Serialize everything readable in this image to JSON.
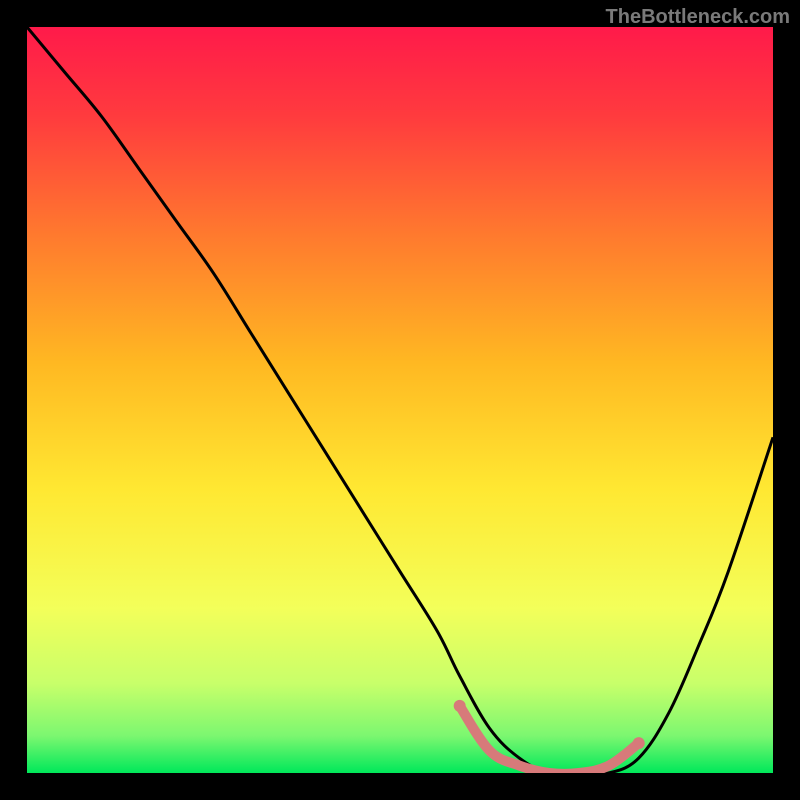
{
  "watermark": "TheBottleneck.com",
  "chart_data": {
    "type": "line",
    "title": "",
    "xlabel": "",
    "ylabel": "",
    "xlim": [
      0,
      100
    ],
    "ylim": [
      0,
      100
    ],
    "grid": false,
    "legend": false,
    "background_gradient": {
      "top_color": "#ff1a4a",
      "mid_color": "#ffd400",
      "bottom_color": "#00e85a"
    },
    "series": [
      {
        "name": "bottleneck-curve",
        "color": "#000000",
        "x": [
          0,
          5,
          10,
          15,
          20,
          25,
          30,
          35,
          40,
          45,
          50,
          55,
          58,
          62,
          66,
          70,
          74,
          78,
          82,
          86,
          90,
          94,
          100
        ],
        "y": [
          100,
          94,
          88,
          81,
          74,
          67,
          59,
          51,
          43,
          35,
          27,
          19,
          13,
          6,
          2,
          0,
          0,
          0,
          2,
          8,
          17,
          27,
          45
        ]
      }
    ],
    "highlight_segment": {
      "name": "optimal-range-marker",
      "color": "#d77a7a",
      "x": [
        58,
        62,
        66,
        70,
        74,
        78,
        82
      ],
      "y": [
        9,
        3,
        1,
        0,
        0,
        1,
        4
      ]
    }
  }
}
